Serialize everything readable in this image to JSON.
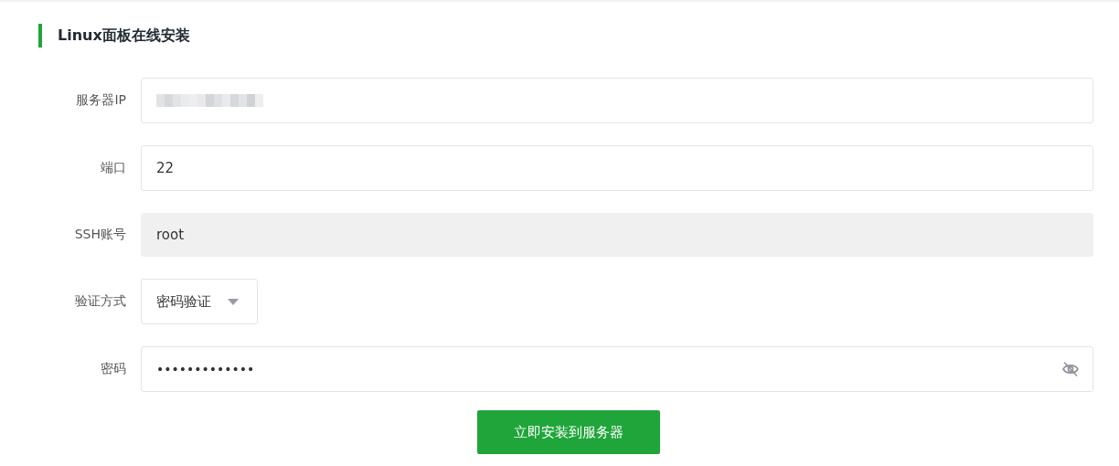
{
  "section": {
    "title": "Linux面板在线安装"
  },
  "fields": [
    {
      "kind": "redacted",
      "label": "服务器IP",
      "disabled": false
    },
    {
      "kind": "text",
      "label": "端口",
      "value": "22",
      "disabled": false
    },
    {
      "kind": "text",
      "label": "SSH账号",
      "value": "root",
      "disabled": true
    },
    {
      "kind": "select",
      "label": "验证方式",
      "value": "密码验证",
      "disabled": false
    },
    {
      "kind": "password",
      "label": "密码",
      "value": "•••••••••••••",
      "masked": true,
      "disabled": false
    }
  ],
  "submit": {
    "label": "立即安装到服务器"
  }
}
